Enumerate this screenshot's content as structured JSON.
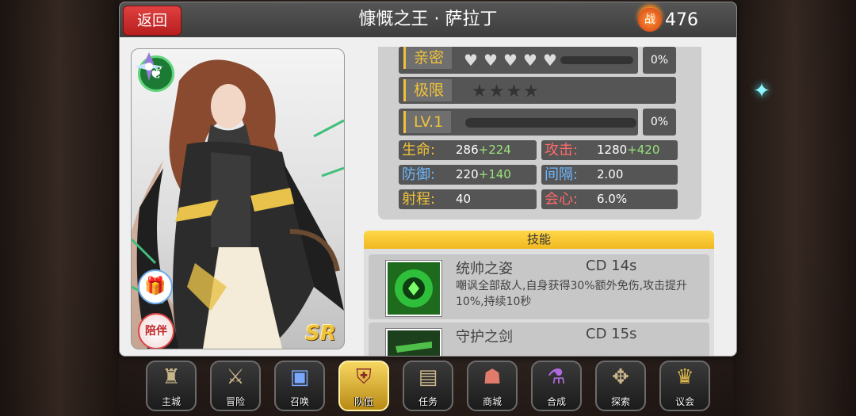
{
  "header": {
    "back_label": "返回",
    "title": "慷慨之王 · 萨拉丁",
    "power_icon_label": "战",
    "power_value": "476"
  },
  "portrait": {
    "rarity": "SR",
    "companion_label": "陪伴"
  },
  "affinity": {
    "label": "亲密",
    "hearts": 5,
    "percent": "0%",
    "fill": 0
  },
  "limit": {
    "label": "极限",
    "stars": 4
  },
  "level": {
    "label": "LV.1",
    "percent": "0%",
    "fill": 0
  },
  "stats": {
    "hp": {
      "label": "生命:",
      "base": "286",
      "bonus": "+224",
      "color": "#f0c23a"
    },
    "atk": {
      "label": "攻击:",
      "base": "1280",
      "bonus": "+420",
      "color": "#ff6b6b"
    },
    "def": {
      "label": "防御:",
      "base": "220",
      "bonus": "+140",
      "color": "#6fb8ff"
    },
    "interval": {
      "label": "间隔:",
      "value": "2.00",
      "color": "#6fb8ff"
    },
    "range": {
      "label": "射程:",
      "value": "40",
      "color": "#f0c23a"
    },
    "crit": {
      "label": "会心:",
      "value": "6.0%",
      "color": "#ff6b6b"
    }
  },
  "skills": {
    "header": "技能",
    "items": [
      {
        "name": "统帅之姿",
        "cd": "CD  14s",
        "desc": "嘲讽全部敌人,自身获得30%额外免伤,攻击提升10%,持续10秒",
        "icon": "commander-skill-icon"
      },
      {
        "name": "守护之剑",
        "cd": "CD  15s",
        "desc": "",
        "icon": "guardian-sword-skill-icon"
      }
    ]
  },
  "nav": [
    {
      "label": "主城",
      "icon": "castle-icon"
    },
    {
      "label": "冒险",
      "icon": "crossed-swords-icon"
    },
    {
      "label": "召唤",
      "icon": "summon-card-icon"
    },
    {
      "label": "队伍",
      "icon": "team-helmet-icon",
      "active": true
    },
    {
      "label": "任务",
      "icon": "quest-scroll-icon"
    },
    {
      "label": "商城",
      "icon": "shop-mushroom-icon"
    },
    {
      "label": "合成",
      "icon": "potion-icon"
    },
    {
      "label": "探索",
      "icon": "compass-icon"
    },
    {
      "label": "议会",
      "icon": "council-crown-icon"
    }
  ],
  "colors": {
    "accent": "#f0c23a",
    "back_button": "#d42a2a",
    "bonus": "#9be27a"
  }
}
